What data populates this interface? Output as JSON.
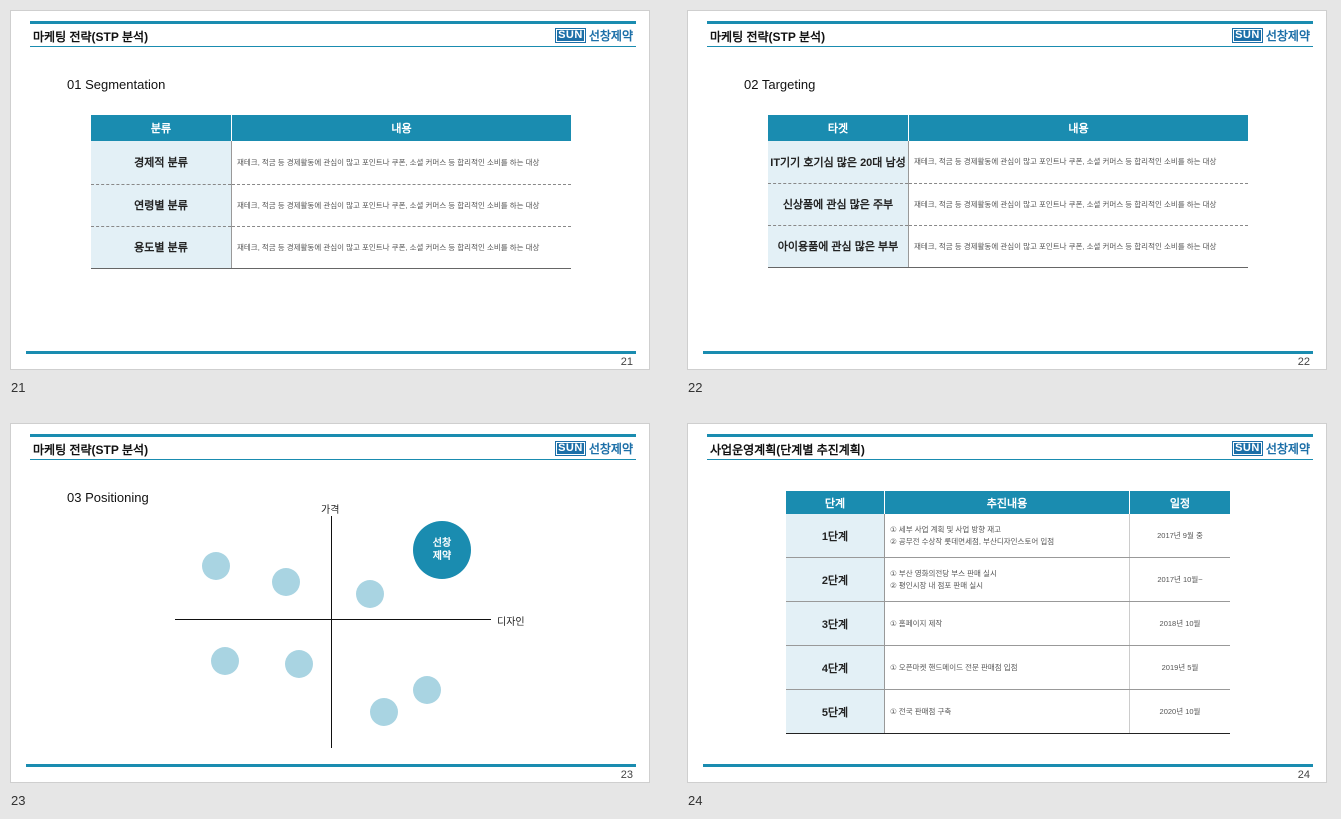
{
  "slides": [
    {
      "number": "21",
      "title": "마케팅 전략(STP 분석)",
      "logo": {
        "box": "SUN",
        "name": "선창제약"
      },
      "page": "21",
      "section": "01 Segmentation",
      "table": {
        "headers": [
          "분류",
          "내용"
        ],
        "rows": [
          [
            "경제적 분류",
            "재테크, 적금 등 경제활동에 관심이 많고 포인트나 쿠폰, 소셜 커머스 등 합리적인 소비를 하는 대상"
          ],
          [
            "연령별 분류",
            "재테크, 적금 등 경제활동에 관심이 많고 포인트나 쿠폰, 소셜 커머스 등 합리적인 소비를 하는 대상"
          ],
          [
            "용도별 분류",
            "재테크, 적금 등 경제활동에 관심이 많고 포인트나 쿠폰, 소셜 커머스 등 합리적인 소비를 하는 대상"
          ]
        ]
      }
    },
    {
      "number": "22",
      "title": "마케팅 전략(STP 분석)",
      "logo": {
        "box": "SUN",
        "name": "선창제약"
      },
      "page": "22",
      "section": "02 Targeting",
      "table": {
        "headers": [
          "타겟",
          "내용"
        ],
        "rows": [
          [
            "IT기기 호기심 많은 20대 남성",
            "재테크, 적금 등 경제활동에 관심이 많고 포인트나 쿠폰, 소셜 커머스 등 합리적인 소비를 하는 대상"
          ],
          [
            "신상품에 관심 많은 주부",
            "재테크, 적금 등 경제활동에 관심이 많고 포인트나 쿠폰, 소셜 커머스 등 합리적인 소비를 하는 대상"
          ],
          [
            "아이용품에 관심 많은 부부",
            "재테크, 적금 등 경제활동에 관심이 많고 포인트나 쿠폰, 소셜 커머스 등 합리적인 소비를 하는 대상"
          ]
        ]
      }
    },
    {
      "number": "23",
      "title": "마케팅 전략(STP 분석)",
      "logo": {
        "box": "SUN",
        "name": "선창제약"
      },
      "page": "23",
      "section": "03 Positioning",
      "y_axis_label": "가격",
      "x_axis_label": "디자인",
      "highlight": "선창\n제약"
    },
    {
      "number": "24",
      "title": "사업운영계획(단계별 추진계획)",
      "logo": {
        "box": "SUN",
        "name": "선창제약"
      },
      "page": "24",
      "table": {
        "headers": [
          "단계",
          "추진내용",
          "일정"
        ],
        "rows": [
          {
            "stage": "1단계",
            "items": [
              "① 세부 사업 계획 및 사업 방향 재고",
              "② 공무전 수상작 롯데면세점, 부산디자인스토어 입점"
            ],
            "date": "2017년 9월 중"
          },
          {
            "stage": "2단계",
            "items": [
              "① 부산 영화의전당 부스 판매 실시",
              "② 평인시장 내 점포 판매 실시"
            ],
            "date": "2017년 10월~"
          },
          {
            "stage": "3단계",
            "items": [
              "① 홈페이지 제작"
            ],
            "date": "2018년 10월"
          },
          {
            "stage": "4단계",
            "items": [
              "① 오픈마켓 핸드메이드 전문 판매점 입점"
            ],
            "date": "2019년 5월"
          },
          {
            "stage": "5단계",
            "items": [
              "① 전국 판매점 구축"
            ],
            "date": "2020년 10월"
          }
        ]
      }
    }
  ]
}
